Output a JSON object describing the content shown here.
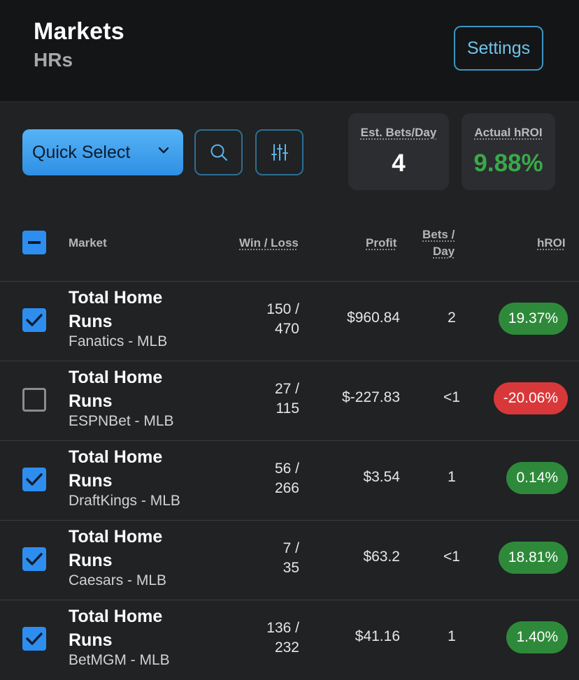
{
  "header": {
    "title": "Markets",
    "subtitle": "HRs",
    "settings_label": "Settings"
  },
  "controls": {
    "quick_select_label": "Quick Select"
  },
  "stats": {
    "est_bets_label": "Est. Bets/Day",
    "est_bets_value": "4",
    "actual_hroi_label": "Actual hROI",
    "actual_hroi_value": "9.88%"
  },
  "colors": {
    "positive": "#2e8a3a",
    "negative": "#d8383a",
    "accent": "#2d8ef0",
    "hroi_text": "#3aa84a"
  },
  "table": {
    "headers": {
      "market": "Market",
      "win_loss": "Win / Loss",
      "profit": "Profit",
      "bets_day_1": "Bets /",
      "bets_day_2": "Day",
      "hroi": "hROI"
    },
    "rows": [
      {
        "checked": true,
        "name": "Total Home Runs",
        "book": "Fanatics - MLB",
        "wins": "150 /",
        "losses": "470",
        "profit": "$960.84",
        "bets_day": "2",
        "hroi": "19.37%",
        "hroi_sign": "pos"
      },
      {
        "checked": false,
        "name": "Total Home Runs",
        "book": "ESPNBet - MLB",
        "wins": "27 /",
        "losses": "115",
        "profit": "$-227.83",
        "bets_day": "<1",
        "hroi": "-20.06%",
        "hroi_sign": "neg"
      },
      {
        "checked": true,
        "name": "Total Home Runs",
        "book": "DraftKings - MLB",
        "wins": "56 /",
        "losses": "266",
        "profit": "$3.54",
        "bets_day": "1",
        "hroi": "0.14%",
        "hroi_sign": "pos"
      },
      {
        "checked": true,
        "name": "Total Home Runs",
        "book": "Caesars - MLB",
        "wins": "7 /",
        "losses": "35",
        "profit": "$63.2",
        "bets_day": "<1",
        "hroi": "18.81%",
        "hroi_sign": "pos"
      },
      {
        "checked": true,
        "name": "Total Home Runs",
        "book": "BetMGM - MLB",
        "wins": "136 /",
        "losses": "232",
        "profit": "$41.16",
        "bets_day": "1",
        "hroi": "1.40%",
        "hroi_sign": "pos"
      }
    ]
  }
}
